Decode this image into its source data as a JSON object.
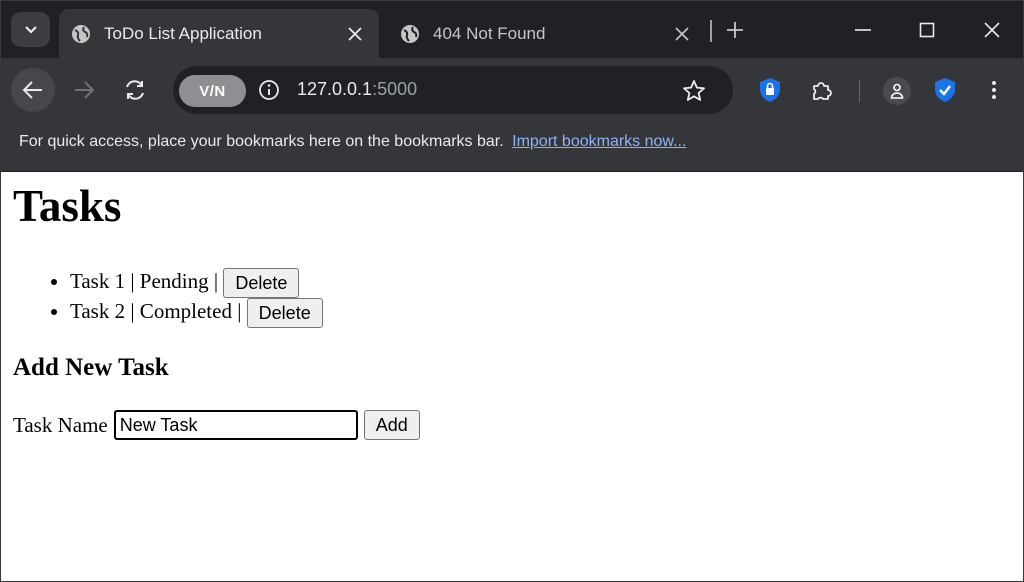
{
  "browser": {
    "tabs": [
      {
        "title": "ToDo List Application",
        "active": true
      },
      {
        "title": "404 Not Found",
        "active": false
      }
    ],
    "toolbar": {
      "vpn_label": "V/N",
      "url_host": "127.0.0.1",
      "url_port": ":5000"
    },
    "bookmarks_bar": {
      "message": "For quick access, place your bookmarks here on the bookmarks bar.",
      "import_link": "Import bookmarks now..."
    }
  },
  "page": {
    "heading": "Tasks",
    "tasks": [
      {
        "text": "Task 1 | Pending |",
        "delete_label": "Delete"
      },
      {
        "text": "Task 2 | Completed |",
        "delete_label": "Delete"
      }
    ],
    "add_section": {
      "heading": "Add New Task",
      "field_label": "Task Name",
      "field_value": "New Task",
      "add_label": "Add"
    }
  },
  "colors": {
    "tabstrip_bg": "#202124",
    "toolbar_bg": "#35363a",
    "link": "#8ab4f8",
    "shield_blue": "#1a73e8"
  }
}
